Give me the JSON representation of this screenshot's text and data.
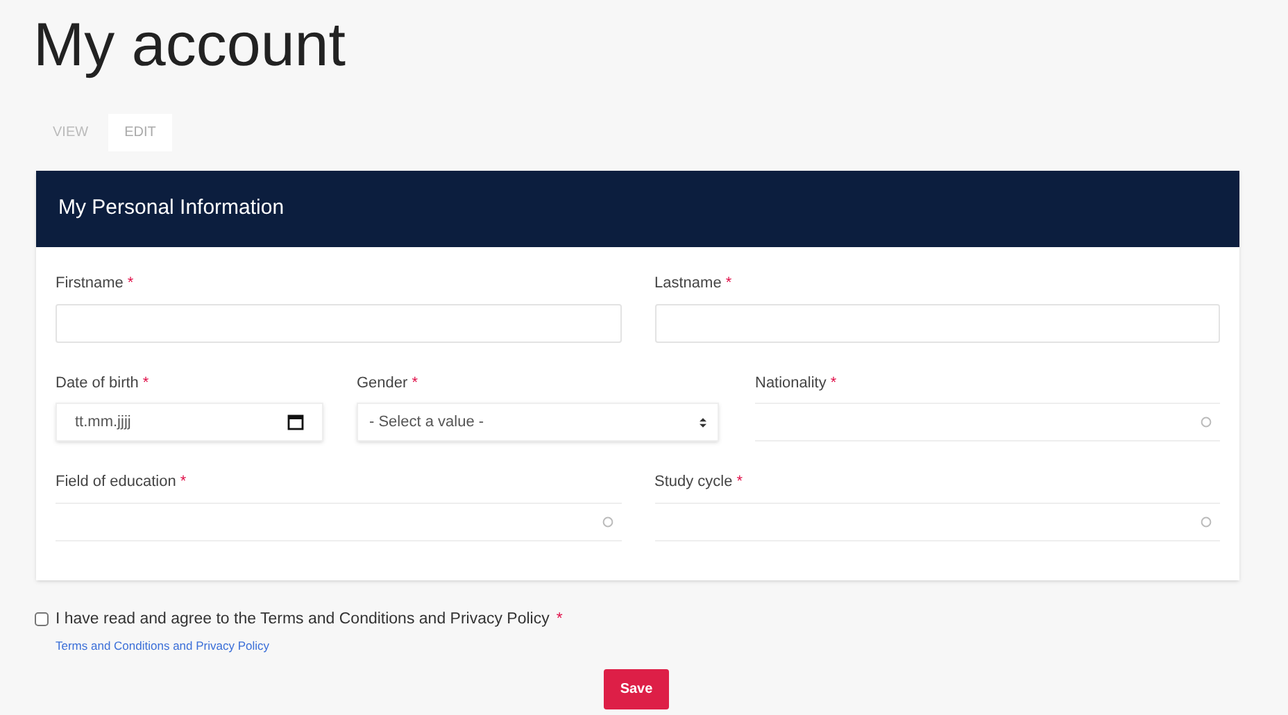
{
  "title": "My account",
  "tabs": [
    {
      "label": "VIEW",
      "selected": false
    },
    {
      "label": "EDIT",
      "selected": true
    }
  ],
  "section": {
    "title": "My Personal Information",
    "rows": [
      [
        {
          "kind": "text",
          "label": "Firstname",
          "required_mark": "*"
        },
        {
          "kind": "text",
          "label": "Lastname",
          "required_mark": "*"
        }
      ],
      [
        {
          "kind": "date",
          "label": "Date of birth",
          "required_mark": "*",
          "placeholder": "tt.mm.jjjj"
        },
        {
          "kind": "select",
          "label": "Gender",
          "required_mark": "*",
          "value": "- Select a value -"
        },
        {
          "kind": "autocomplete",
          "label": "Nationality",
          "required_mark": "*"
        }
      ],
      [
        {
          "kind": "autocomplete",
          "label": "Field of education",
          "required_mark": "*"
        },
        {
          "kind": "autocomplete",
          "label": "Study cycle",
          "required_mark": "*"
        }
      ]
    ]
  },
  "agreement": {
    "label": "I have read and agree to the Terms and Conditions and Privacy Policy",
    "required_mark": "*",
    "checked": false,
    "link": "Terms and Conditions and Privacy Policy"
  },
  "save_button": "Save"
}
